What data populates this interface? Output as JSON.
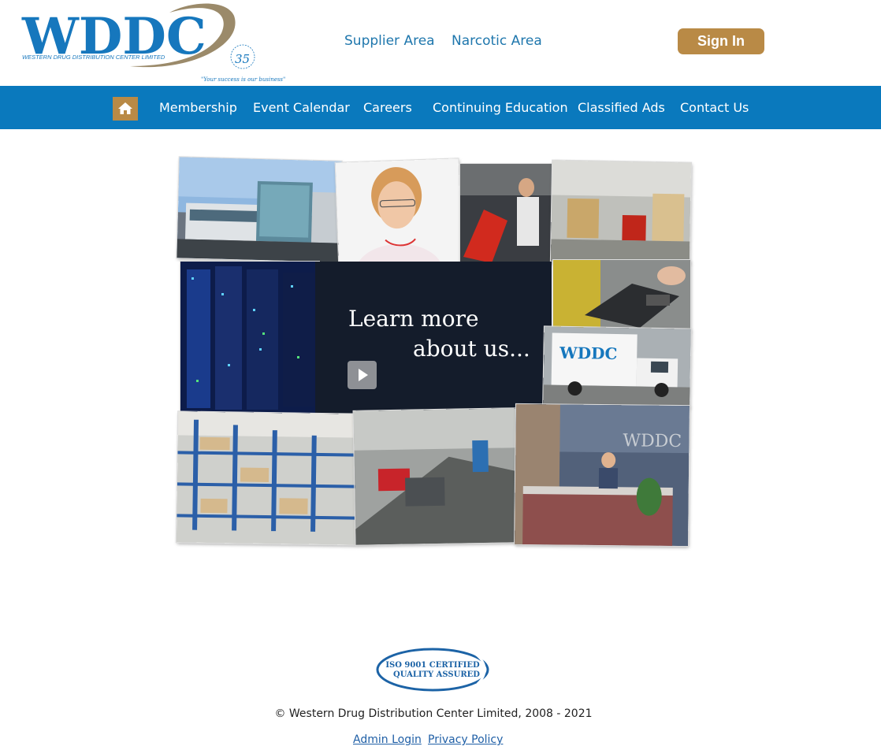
{
  "header": {
    "logo_text": "WDDC",
    "logo_company": "WESTERN DRUG DISTRIBUTION CENTER LIMITED",
    "logo_tagline": "\"Your success is our business\"",
    "logo_badge": "35",
    "links": [
      "Supplier Area",
      "Narcotic Area"
    ],
    "sign_in": "Sign In"
  },
  "nav": {
    "home_icon": "home-icon",
    "items": [
      "Membership",
      "Event Calendar",
      "Careers",
      "Continuing Education",
      "Classified Ads",
      "Contact Us"
    ]
  },
  "hero": {
    "line1": "Learn more",
    "line2": "about us...",
    "play_icon": "play-icon",
    "truck_logo": "WDDC",
    "sign_logo": "WDDC"
  },
  "footer": {
    "iso_line1": "ISO 9001 CERTIFIED",
    "iso_line2": "QUALITY ASSURED",
    "copyright": "© Western Drug Distribution Center Limited, 2008 - 2021",
    "links": [
      "Admin Login",
      "Privacy Policy"
    ]
  },
  "colors": {
    "brand_blue": "#0a79bd",
    "accent_gold": "#b98a46",
    "link_blue": "#1f77ad"
  }
}
